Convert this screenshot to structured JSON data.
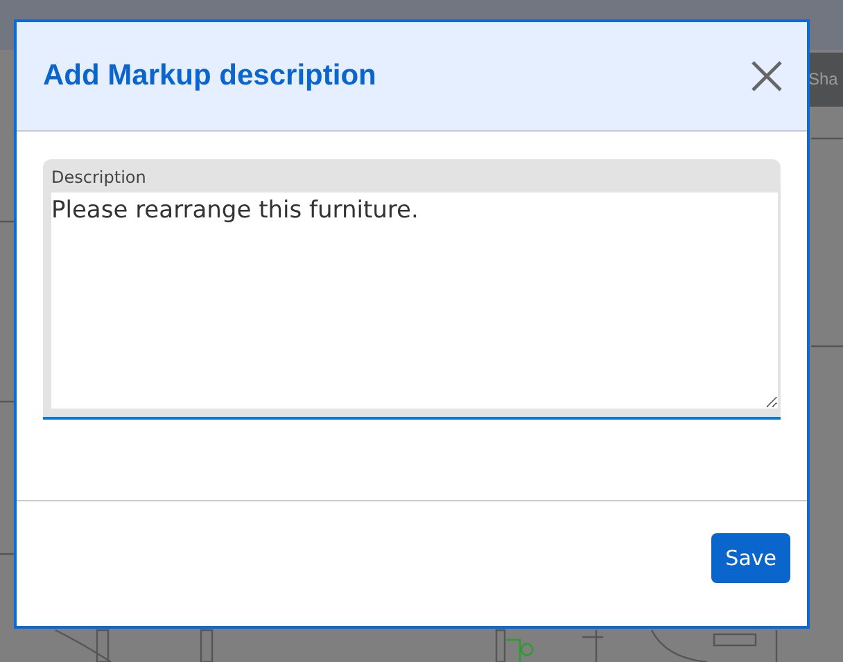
{
  "background": {
    "share_button": "Sha"
  },
  "dialog": {
    "title": "Add Markup description",
    "field": {
      "label": "Description",
      "value": "Please rearrange this furniture."
    },
    "buttons": [
      {
        "label": "Save",
        "kind": "primary"
      }
    ]
  }
}
